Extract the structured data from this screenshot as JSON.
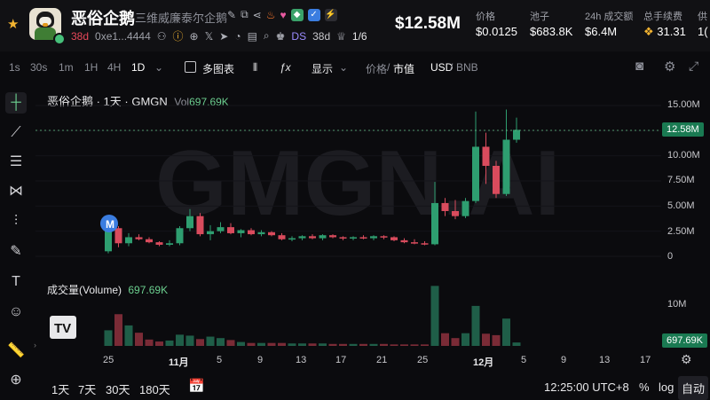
{
  "token": {
    "name": "恶俗企鹅",
    "full_name": "三维威廉泰尔企鹅",
    "age": "38d",
    "address": "0xe1...4444",
    "ds_label": "DS",
    "ds_age": "38d",
    "progress": "1/6"
  },
  "price_big": "$12.58M",
  "stats": [
    {
      "label": "价格",
      "value": "$0.0125"
    },
    {
      "label": "池子",
      "value": "$683.8K"
    },
    {
      "label": "24h 成交额",
      "value": "$6.4M"
    },
    {
      "label": "总手续费",
      "value": "31.31"
    },
    {
      "label": "供",
      "value": "1("
    }
  ],
  "toolbar": {
    "intervals": [
      "1s",
      "30s",
      "1m",
      "1H",
      "4H",
      "1D"
    ],
    "active_interval": "1D",
    "multi_chart": "多图表",
    "display": "显示",
    "price_label": "价格",
    "mcap_label": "市值",
    "usd_label": "USD",
    "bnb_label": "BNB"
  },
  "chart_data": {
    "type": "candlestick",
    "title": "恶俗企鹅 · 1天 · GMGN",
    "watermark": "GMGN.AI",
    "volume_label": "Vol",
    "volume_value": "697.69K",
    "volume_pane_title": "成交量(Volume)",
    "volume_pane_value": "697.69K",
    "current_value_label": "12.58M",
    "current_value": 12.58,
    "y_unit": "M",
    "ylim": [
      -0.5,
      16.5
    ],
    "y_ticks": [
      "15.00M",
      "12.50M",
      "10.00M",
      "7.50M",
      "5.00M",
      "2.50M",
      "0"
    ],
    "y_tick_values": [
      15,
      12.5,
      10,
      7.5,
      5,
      2.5,
      0
    ],
    "volume_tick": "10M",
    "x_ticks": [
      "25",
      "11月",
      "5",
      "9",
      "13",
      "17",
      "21",
      "25",
      "12月",
      "5",
      "9",
      "13",
      "17"
    ],
    "marker_label": "M",
    "candles": [
      {
        "o": 0.5,
        "h": 3.6,
        "l": 0.3,
        "c": 2.8,
        "v": 3.2
      },
      {
        "o": 2.8,
        "h": 3.0,
        "l": 0.9,
        "c": 1.3,
        "v": 6.5
      },
      {
        "o": 1.3,
        "h": 2.3,
        "l": 1.0,
        "c": 1.9,
        "v": 4.2
      },
      {
        "o": 1.9,
        "h": 2.2,
        "l": 1.6,
        "c": 1.7,
        "v": 2.7
      },
      {
        "o": 1.7,
        "h": 1.9,
        "l": 1.3,
        "c": 1.4,
        "v": 1.3
      },
      {
        "o": 1.4,
        "h": 1.5,
        "l": 1.0,
        "c": 1.15,
        "v": 0.9
      },
      {
        "o": 1.15,
        "h": 1.6,
        "l": 1.0,
        "c": 1.3,
        "v": 1.1
      },
      {
        "o": 1.3,
        "h": 3.0,
        "l": 1.1,
        "c": 2.8,
        "v": 2.3
      },
      {
        "o": 2.8,
        "h": 4.7,
        "l": 2.5,
        "c": 4.0,
        "v": 2.1
      },
      {
        "o": 4.0,
        "h": 4.3,
        "l": 2.0,
        "c": 2.2,
        "v": 1.4
      },
      {
        "o": 2.2,
        "h": 3.1,
        "l": 1.6,
        "c": 2.5,
        "v": 1.9
      },
      {
        "o": 2.5,
        "h": 3.4,
        "l": 2.3,
        "c": 2.9,
        "v": 1.6
      },
      {
        "o": 2.9,
        "h": 3.3,
        "l": 2.2,
        "c": 2.3,
        "v": 1.2
      },
      {
        "o": 2.3,
        "h": 2.7,
        "l": 1.9,
        "c": 2.6,
        "v": 0.8
      },
      {
        "o": 2.6,
        "h": 2.8,
        "l": 2.1,
        "c": 2.2,
        "v": 0.6
      },
      {
        "o": 2.2,
        "h": 2.6,
        "l": 2.0,
        "c": 2.4,
        "v": 0.6
      },
      {
        "o": 2.4,
        "h": 2.5,
        "l": 2.0,
        "c": 2.1,
        "v": 0.6
      },
      {
        "o": 2.1,
        "h": 2.3,
        "l": 1.6,
        "c": 1.7,
        "v": 0.6
      },
      {
        "o": 1.7,
        "h": 2.0,
        "l": 1.5,
        "c": 1.8,
        "v": 0.5
      },
      {
        "o": 1.8,
        "h": 2.1,
        "l": 1.6,
        "c": 2.0,
        "v": 0.5
      },
      {
        "o": 2.0,
        "h": 2.2,
        "l": 1.7,
        "c": 1.8,
        "v": 0.5
      },
      {
        "o": 1.8,
        "h": 2.2,
        "l": 1.6,
        "c": 2.1,
        "v": 0.5
      },
      {
        "o": 2.1,
        "h": 2.2,
        "l": 1.8,
        "c": 1.9,
        "v": 0.4
      },
      {
        "o": 1.9,
        "h": 2.0,
        "l": 1.6,
        "c": 1.8,
        "v": 0.4
      },
      {
        "o": 1.8,
        "h": 2.0,
        "l": 1.6,
        "c": 1.9,
        "v": 0.4
      },
      {
        "o": 1.9,
        "h": 2.1,
        "l": 1.7,
        "c": 1.8,
        "v": 0.4
      },
      {
        "o": 1.8,
        "h": 2.1,
        "l": 1.6,
        "c": 2.0,
        "v": 0.4
      },
      {
        "o": 2.0,
        "h": 2.1,
        "l": 1.7,
        "c": 1.9,
        "v": 0.4
      },
      {
        "o": 1.9,
        "h": 2.0,
        "l": 1.5,
        "c": 1.6,
        "v": 0.3
      },
      {
        "o": 1.6,
        "h": 1.8,
        "l": 1.3,
        "c": 1.4,
        "v": 0.3
      },
      {
        "o": 1.4,
        "h": 1.7,
        "l": 1.2,
        "c": 1.3,
        "v": 0.3
      },
      {
        "o": 1.3,
        "h": 1.5,
        "l": 1.1,
        "c": 1.2,
        "v": 0.3
      },
      {
        "o": 1.2,
        "h": 7.4,
        "l": 1.1,
        "c": 5.3,
        "v": 12.3
      },
      {
        "o": 5.3,
        "h": 5.8,
        "l": 4.0,
        "c": 4.5,
        "v": 2.6
      },
      {
        "o": 4.5,
        "h": 5.6,
        "l": 3.7,
        "c": 4.0,
        "v": 1.6
      },
      {
        "o": 4.0,
        "h": 5.8,
        "l": 3.8,
        "c": 5.5,
        "v": 2.6
      },
      {
        "o": 5.5,
        "h": 14.4,
        "l": 5.3,
        "c": 10.9,
        "v": 8.2
      },
      {
        "o": 10.9,
        "h": 12.3,
        "l": 7.2,
        "c": 9.0,
        "v": 2.5
      },
      {
        "o": 9.0,
        "h": 9.5,
        "l": 5.8,
        "c": 6.2,
        "v": 2.2
      },
      {
        "o": 6.2,
        "h": 14.6,
        "l": 6.0,
        "c": 11.6,
        "v": 5.6
      },
      {
        "o": 11.6,
        "h": 13.8,
        "l": 11.3,
        "c": 12.58,
        "v": 0.7
      }
    ]
  },
  "bottom": {
    "ranges": [
      "1天",
      "7天",
      "30天",
      "180天"
    ],
    "time": "12:25:00 UTC+8",
    "percent": "%",
    "log": "log",
    "auto": "自动"
  }
}
